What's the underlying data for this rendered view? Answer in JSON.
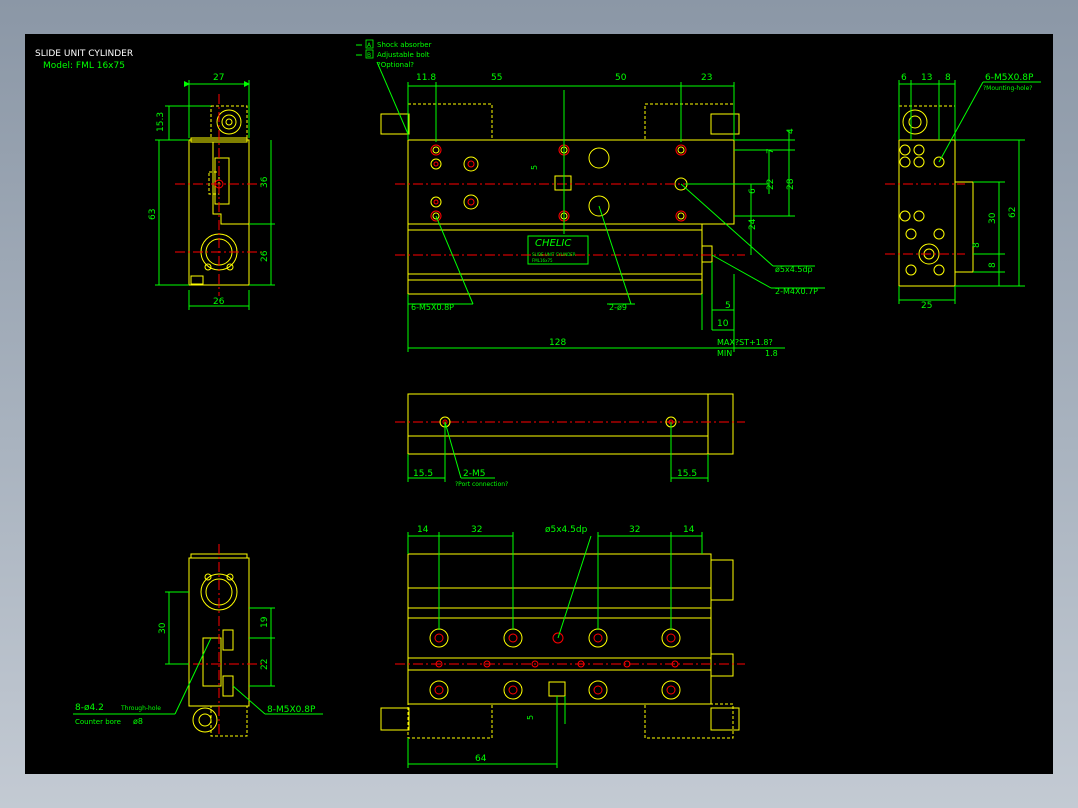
{
  "title": {
    "line1": "SLIDE UNIT CYLINDER",
    "line2": "Model: FML 16x75"
  },
  "legend": {
    "item1": "Shock absorber",
    "item2": "Adjustable bolt",
    "item3": "?Optional?",
    "mark1": "A",
    "mark2": "B"
  },
  "brand": {
    "logo": "CHELIC",
    "sub1": "SLIDE UNIT CYLINDER",
    "sub2": "FML16x75"
  },
  "dims": {
    "d27": "27",
    "d15_3": "15.3",
    "d63": "63",
    "d36": "36",
    "d26v": "26",
    "d26h": "26",
    "d11_8": "11.8",
    "d55": "55",
    "d50": "50",
    "d23": "23",
    "d4": "4",
    "d7": "7",
    "d22": "22",
    "d28": "28",
    "d6": "6",
    "d24": "24",
    "d5a": "5",
    "d5b": "5",
    "d10": "10",
    "d128": "128",
    "max": "MAX?ST+1.8?",
    "min": "MIN",
    "min_val": "1.8",
    "callout_5x4": "ø5x4.5dp",
    "callout_m4": "2-M4X0.7P",
    "callout_m5_6": "6-M5X0.8P",
    "callout_phi9": "2-ø9",
    "r_6": "6",
    "r_13": "13",
    "r_8": "8",
    "r_m5": "6-M5X0.8P",
    "r_mount": "?Mounting-hole?",
    "r_30": "30",
    "r_62": "62",
    "r_8a": "8",
    "r_8b": "8",
    "r_25": "25",
    "m_15_5a": "15.5",
    "m_15_5b": "15.5",
    "m_2m5": "2-M5",
    "m_port": "?Port connection?",
    "b_14a": "14",
    "b_32a": "32",
    "b_dp": "ø5x4.5dp",
    "b_32b": "32",
    "b_14b": "14",
    "b_5": "5",
    "b_64": "64",
    "bl_30": "30",
    "bl_19": "19",
    "bl_22": "22",
    "bl_hole": "8-ø4.2",
    "bl_through": "Through-hole",
    "bl_cbore": "Counter bore",
    "bl_phi8": "ø8",
    "bl_m5": "8-M5X0.8P"
  },
  "colors": {
    "outline": "#ffff00",
    "dimension": "#00ff00",
    "center": "#ff0000",
    "hidden": "#ffff00",
    "text": "#ffffff"
  }
}
